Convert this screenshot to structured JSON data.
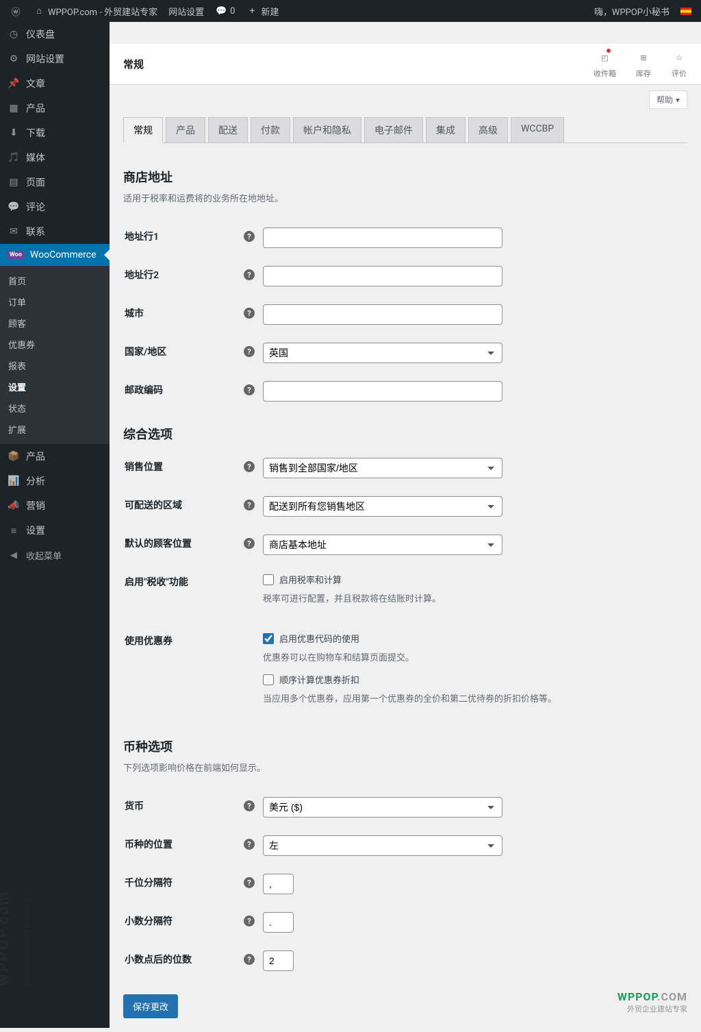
{
  "adminBar": {
    "siteTitle": "WPPOP.com - 外贸建站专家",
    "siteSettings": "网站设置",
    "commentCount": "0",
    "newItem": "新建",
    "greeting": "嗨，WPPOP小秘书"
  },
  "sidebar": {
    "items": [
      {
        "label": "仪表盘"
      },
      {
        "label": "网站设置"
      },
      {
        "label": "文章"
      },
      {
        "label": "产品"
      },
      {
        "label": "下载"
      },
      {
        "label": "媒体"
      },
      {
        "label": "页面"
      },
      {
        "label": "评论"
      },
      {
        "label": "联系"
      },
      {
        "label": "WooCommerce"
      },
      {
        "label": "产品"
      },
      {
        "label": "分析"
      },
      {
        "label": "营销"
      },
      {
        "label": "设置"
      }
    ],
    "submenu": [
      {
        "label": "首页"
      },
      {
        "label": "订单"
      },
      {
        "label": "顾客"
      },
      {
        "label": "优惠券"
      },
      {
        "label": "报表"
      },
      {
        "label": "设置"
      },
      {
        "label": "状态"
      },
      {
        "label": "扩展"
      }
    ],
    "collapse": "收起菜单"
  },
  "wcHeader": {
    "title": "常规",
    "tabs": [
      {
        "label": "收件箱"
      },
      {
        "label": "库存"
      },
      {
        "label": "评价"
      }
    ]
  },
  "helpLabel": "帮助",
  "navTabs": [
    "常规",
    "产品",
    "配送",
    "付款",
    "帐户和隐私",
    "电子邮件",
    "集成",
    "高级",
    "WCCBP"
  ],
  "sections": {
    "address": {
      "heading": "商店地址",
      "desc": "适用于税率和运费将的业务所在地地址。",
      "fields": {
        "addr1": "地址行1",
        "addr2": "地址行2",
        "city": "城市",
        "country": "国家/地区",
        "countryValue": "英国",
        "postcode": "邮政编码"
      }
    },
    "general": {
      "heading": "综合选项",
      "fields": {
        "sellLoc": "销售位置",
        "sellLocValue": "销售到全部国家/地区",
        "shipLoc": "可配送的区域",
        "shipLocValue": "配送到所有您销售地区",
        "defaultCustLoc": "默认的顾客位置",
        "defaultCustLocValue": "商店基本地址",
        "enableTax": "启用\"税收\"功能",
        "enableTaxCheck": "启用税率和计算",
        "enableTaxDesc": "税率可进行配置，并且税款将在结账时计算。",
        "useCoupons": "使用优惠券",
        "useCouponsCheck": "启用优惠代码的使用",
        "useCouponsDesc": "优惠券可以在购物车和结算页面提交。",
        "seqCouponsCheck": "顺序计算优惠券折扣",
        "seqCouponsDesc": "当应用多个优惠券，应用第一个优惠券的全价和第二优待券的折扣价格等。"
      }
    },
    "currency": {
      "heading": "币种选项",
      "desc": "下列选项影响价格在前端如何显示。",
      "fields": {
        "currency": "货币",
        "currencyValue": "美元 ($)",
        "position": "币种的位置",
        "positionValue": "左",
        "thousand": "千位分隔符",
        "thousandValue": ",",
        "decimal": "小数分隔符",
        "decimalValue": ".",
        "decimals": "小数点后的位数",
        "decimalsValue": "2"
      }
    }
  },
  "saveButton": "保存更改",
  "watermark": {
    "brand": "WPPOP",
    "brandCom": ".COM",
    "tagline": "外贸企业建站专家",
    "side": "WPPOP.com",
    "side2": "WORDPRESS外贸建站专家"
  }
}
